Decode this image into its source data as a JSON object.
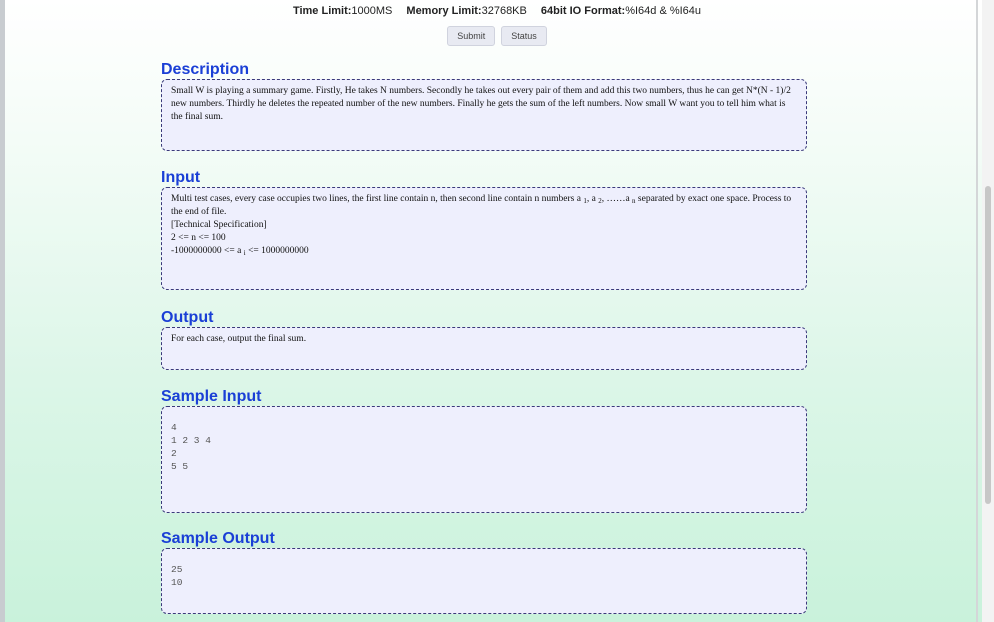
{
  "header": {
    "time_limit_label": "Time Limit:",
    "time_limit_value": "1000MS",
    "memory_limit_label": "Memory Limit:",
    "memory_limit_value": "32768KB",
    "io_format_label": "64bit IO Format:",
    "io_format_value": "%I64d & %I64u"
  },
  "actions": {
    "submit_label": "Submit",
    "status_label": "Status"
  },
  "description": {
    "title": "Description",
    "text": "Small W is playing a summary game. Firstly, He takes N numbers. Secondly he takes out every pair of them and add this two numbers, thus he can get N*(N - 1)/2 new numbers. Thirdly he deletes the repeated number of the new numbers. Finally he gets the sum of the left numbers. Now small W want you to tell him what is the final sum."
  },
  "input": {
    "title": "Input",
    "line1_pre": "Multi test cases, every case occupies two lines, the first line contain n, then second line contain n numbers a ",
    "sub_1": "1",
    "sep_1": ", a ",
    "sub_2": "2",
    "sep_2": ", ……a ",
    "sub_n": "n",
    "line1_post": " separated by exact one space. Process to the end of file.",
    "spec_heading": "[Technical Specification]",
    "spec_n": "2 <= n <= 100",
    "spec_a_pre": "-1000000000 <= a ",
    "sub_i": "i",
    "spec_a_post": " <= 1000000000"
  },
  "output": {
    "title": "Output",
    "text": "For each case, output the final sum."
  },
  "sample_input": {
    "title": "Sample Input",
    "text": "4\n1 2 3 4\n2\n5 5"
  },
  "sample_output": {
    "title": "Sample Output",
    "text": "25\n10"
  }
}
